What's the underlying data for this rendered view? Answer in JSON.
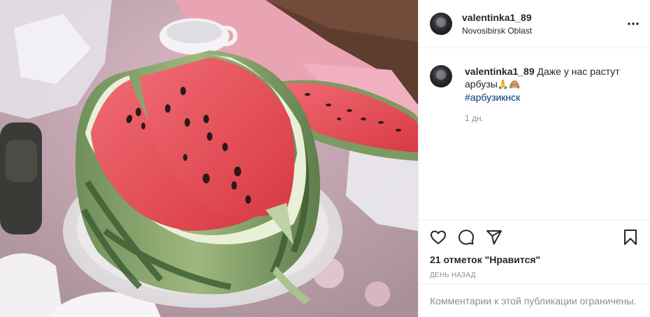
{
  "post": {
    "username": "valentinka1_89",
    "location": "Novosibirsk Oblast",
    "caption": {
      "username": "valentinka1_89",
      "text": "Даже у нас растут арбузы",
      "emojis": [
        "🙏",
        "🙈"
      ],
      "hashtag": "#арбузикнск",
      "age": "1 дн."
    },
    "likes_text": "21 отметок \"Нравится\"",
    "date_text": "ДЕНЬ НАЗАД",
    "comments_disabled_text": "Комментарии к этой публикации ограничены."
  },
  "icons": {
    "more": "more-options-icon",
    "like": "heart-icon",
    "comment": "comment-bubble-icon",
    "share": "paper-plane-icon",
    "save": "bookmark-icon"
  },
  "colors": {
    "text": "#262626",
    "secondary": "#8e8e8e",
    "hashtag": "#00376b",
    "border": "#efefef"
  }
}
